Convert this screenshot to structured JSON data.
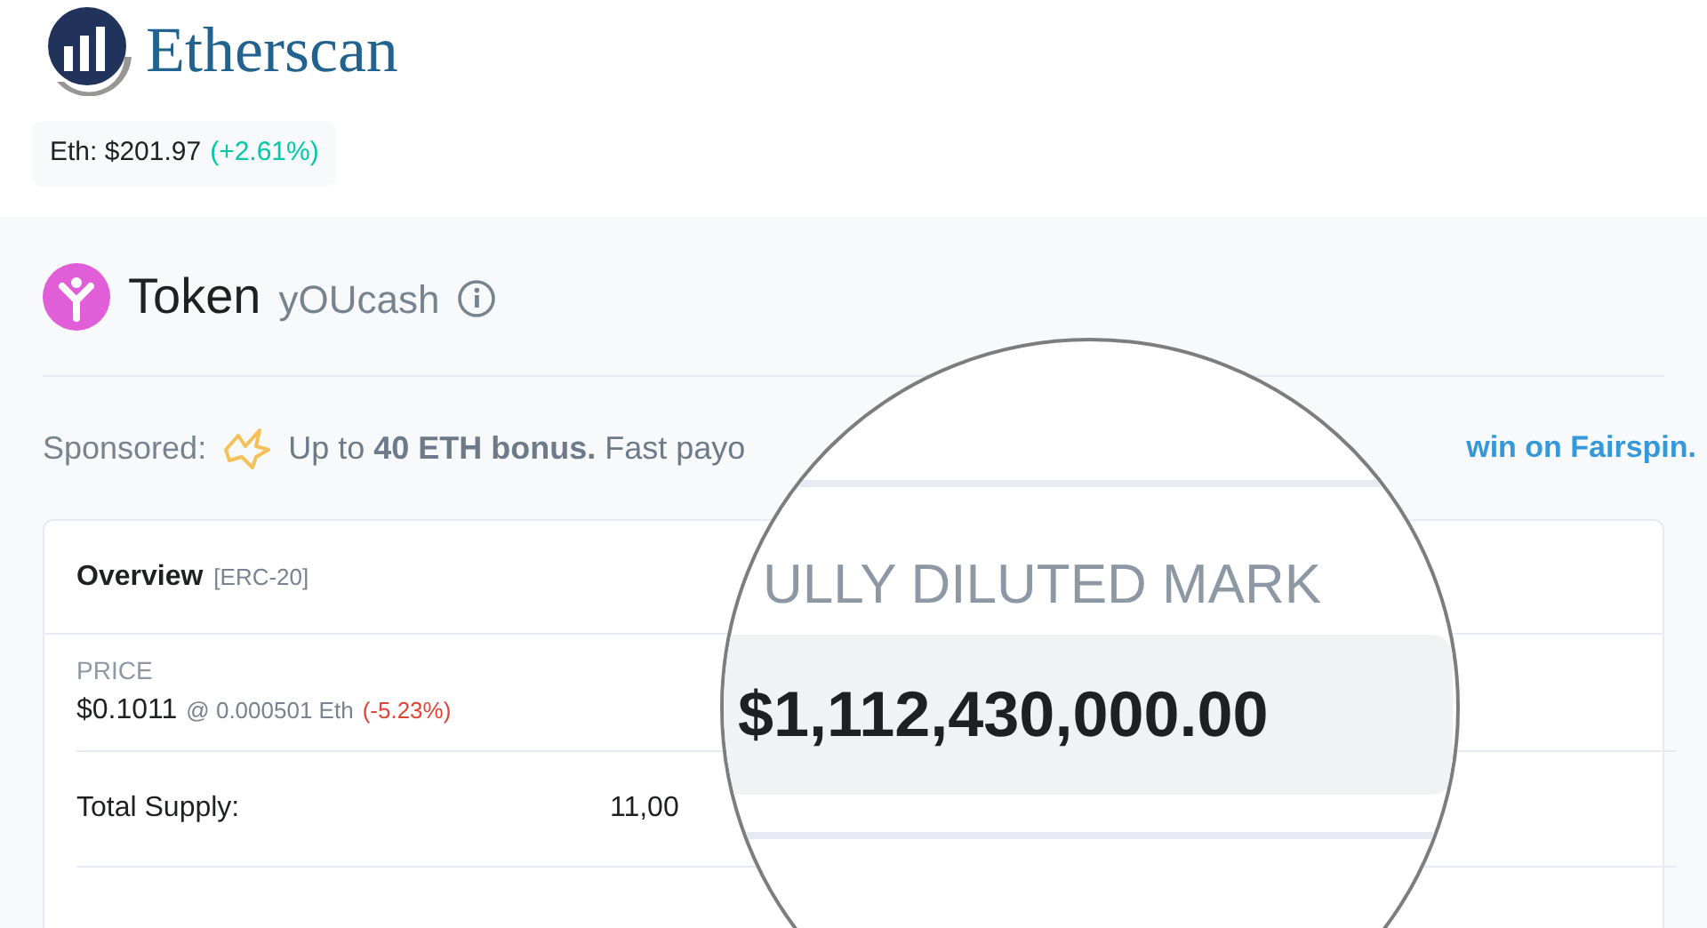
{
  "header": {
    "brand": "Etherscan",
    "eth_price": {
      "label": "Eth: $201.97",
      "change": "(+2.61%)"
    }
  },
  "token": {
    "kind_label": "Token",
    "name": "yOUcash"
  },
  "sponsored": {
    "label": "Sponsored:",
    "text": "Up to **40 ETH bonus.** Fast payo",
    "link": "win on Fairspin."
  },
  "overview": {
    "title": "Overview",
    "standard": "[ERC-20]",
    "price": {
      "label": "PRICE",
      "value": "$0.1011",
      "eth": "@ 0.000501 Eth",
      "change": "(-5.23%)"
    },
    "rows": [
      {
        "label": "Total Supply:",
        "value": "11,00"
      }
    ]
  },
  "magnifier": {
    "label": "ULLY DILUTED MARK",
    "value": "$1,112,430,000.00"
  }
}
